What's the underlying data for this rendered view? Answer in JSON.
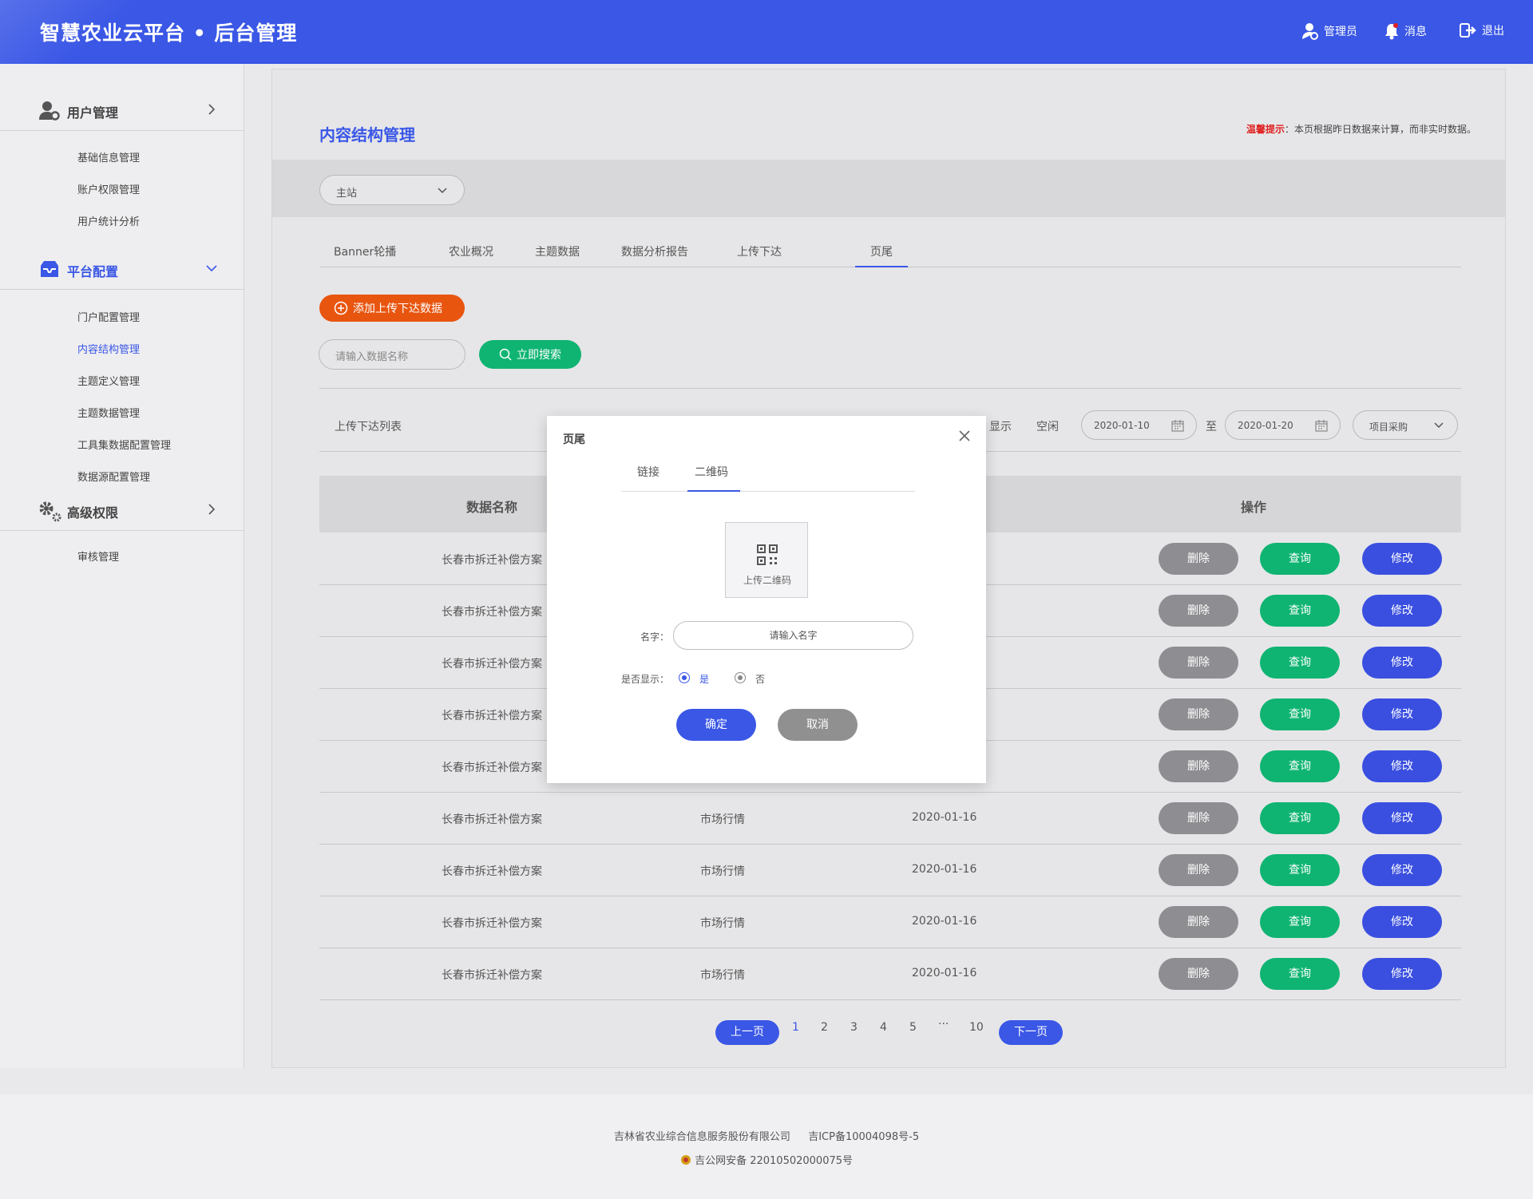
{
  "header": {
    "title": "智慧农业云平台 • 后台管理",
    "admin": "管理员",
    "messages": "消息",
    "logout": "退出"
  },
  "sidebar": {
    "groups": [
      {
        "label": "用户管理",
        "icon": "user-gear-icon",
        "items": [
          "基础信息管理",
          "账户权限管理",
          "用户统计分析"
        ]
      },
      {
        "label": "平台配置",
        "icon": "inbox-icon",
        "items": [
          "门户配置管理",
          "内容结构管理",
          "主题定义管理",
          "主题数据管理",
          "工具集数据配置管理",
          "数据源配置管理"
        ]
      },
      {
        "label": "高级权限",
        "icon": "gears-icon",
        "items": [
          "审核管理"
        ]
      }
    ],
    "active_item": "内容结构管理"
  },
  "main": {
    "page_title": "内容结构管理",
    "tip_label": "温馨提示",
    "tip_text": "：本页根据昨日数据来计算，而非实时数据。",
    "site_select": "主站",
    "tabs": [
      "Banner轮播",
      "农业概况",
      "主题数据",
      "数据分析报告",
      "上传下达",
      "页尾"
    ],
    "active_tab": "页尾",
    "add_button": "添加上传下达数据",
    "search_placeholder": "请输入数据名称",
    "search_button": "立即搜索",
    "list_title": "上传下达列表",
    "filter_show": "显示",
    "filter_idle": "空闲",
    "date_from": "2020-01-10",
    "date_sep": "至",
    "date_to": "2020-01-20",
    "project_select": "项目采购",
    "columns": {
      "name": "数据名称",
      "actions": "操作"
    },
    "rows": [
      {
        "name": "长春市拆迁补偿方案",
        "type": "",
        "date": ""
      },
      {
        "name": "长春市拆迁补偿方案",
        "type": "",
        "date": ""
      },
      {
        "name": "长春市拆迁补偿方案",
        "type": "",
        "date": ""
      },
      {
        "name": "长春市拆迁补偿方案",
        "type": "",
        "date": ""
      },
      {
        "name": "长春市拆迁补偿方案",
        "type": "",
        "date": ""
      },
      {
        "name": "长春市拆迁补偿方案",
        "type": "市场行情",
        "date": "2020-01-16"
      },
      {
        "name": "长春市拆迁补偿方案",
        "type": "市场行情",
        "date": "2020-01-16"
      },
      {
        "name": "长春市拆迁补偿方案",
        "type": "市场行情",
        "date": "2020-01-16"
      },
      {
        "name": "长春市拆迁补偿方案",
        "type": "市场行情",
        "date": "2020-01-16"
      }
    ],
    "actions": {
      "delete": "删除",
      "query": "查询",
      "edit": "修改"
    },
    "pagination": {
      "prev": "上一页",
      "pages": [
        "1",
        "2",
        "3",
        "4",
        "5",
        "···",
        "10"
      ],
      "current": "1",
      "next": "下一页"
    }
  },
  "modal": {
    "title": "页尾",
    "tabs": [
      "链接",
      "二维码"
    ],
    "active_tab": "二维码",
    "upload_label": "上传二维码",
    "name_label": "名字：",
    "name_placeholder": "请输入名字",
    "show_label": "是否显示：",
    "option_yes": "是",
    "option_no": "否",
    "confirm": "确定",
    "cancel": "取消"
  },
  "footer": {
    "company": "吉林省农业综合信息服务股份有限公司",
    "icp": "吉ICP备10004098号-5",
    "police": "吉公网安备 22010502000075号"
  },
  "colors": {
    "primary": "#3a57e6",
    "orange": "#e8550f",
    "green": "#0fb472",
    "gray": "#8e8e92",
    "alert": "#e02020"
  }
}
